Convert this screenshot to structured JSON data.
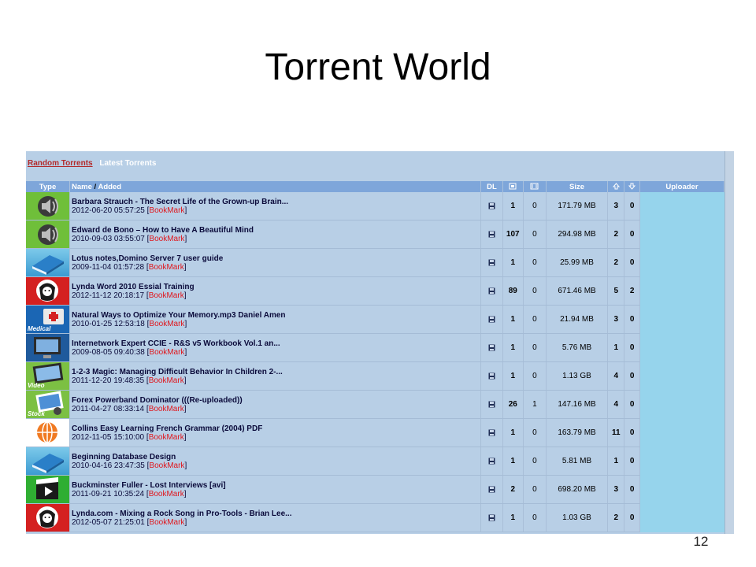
{
  "slide": {
    "title": "Torrent World",
    "page_number": "12"
  },
  "tabs": {
    "random": "Random Torrents",
    "latest": "Latest Torrents"
  },
  "columns": {
    "type": "Type",
    "name": "Name",
    "slash": "/",
    "added": "Added",
    "dl": "DL",
    "size": "Size",
    "uploader": "Uploader"
  },
  "icons": {
    "download": "floppy-disk-icon",
    "seeders_header": "seeders-icon",
    "leechers_header": "leechers-icon",
    "up_header": "arrow-up-icon",
    "down_header": "arrow-down-icon"
  },
  "colors": {
    "header_bg": "#7ea6da",
    "row_bg": "#b8cfe6",
    "bookmark": "#e0151b",
    "uploader_bg": "#96d4ec",
    "random_tab": "#b32a2a"
  },
  "bookmark_label": "BookMark",
  "rows": [
    {
      "thumb": "speaker",
      "thumb_label": "",
      "name": "Barbara Strauch - The Secret Life of the Grown-up Brain...",
      "date": "2012-06-20 05:57:25",
      "seeders": "1",
      "leechers": "0",
      "size": "171.79 MB",
      "up": "3",
      "down": "0"
    },
    {
      "thumb": "speaker",
      "thumb_label": "",
      "name": "Edward de Bono – How to Have A Beautiful Mind",
      "date": "2010-09-03 03:55:07",
      "seeders": "107",
      "leechers": "0",
      "size": "294.98 MB",
      "up": "2",
      "down": "0"
    },
    {
      "thumb": "book",
      "thumb_label": "",
      "name": "Lotus notes,Domino Server 7 user guide",
      "date": "2009-11-04 01:57:28",
      "seeders": "1",
      "leechers": "0",
      "size": "25.99 MB",
      "up": "2",
      "down": "0"
    },
    {
      "thumb": "lynda",
      "thumb_label": "",
      "name": "Lynda Word 2010 Essial Training",
      "date": "2012-11-12 20:18:17",
      "seeders": "89",
      "leechers": "0",
      "size": "671.46 MB",
      "up": "5",
      "down": "2"
    },
    {
      "thumb": "medical",
      "thumb_label": "Medical",
      "name": "Natural Ways to Optimize Your Memory.mp3 Daniel Amen",
      "date": "2010-01-25 12:53:18",
      "seeders": "1",
      "leechers": "0",
      "size": "21.94 MB",
      "up": "3",
      "down": "0"
    },
    {
      "thumb": "network",
      "thumb_label": "",
      "name": "Internetwork Expert CCIE - R&S v5 Workbook Vol.1 an...",
      "date": "2009-08-05 09:40:38",
      "seeders": "1",
      "leechers": "0",
      "size": "5.76 MB",
      "up": "1",
      "down": "0"
    },
    {
      "thumb": "video",
      "thumb_label": "Video",
      "name": "1-2-3 Magic: Managing Difficult Behavior In Children 2-...",
      "date": "2011-12-20 19:48:35",
      "seeders": "1",
      "leechers": "0",
      "size": "1.13 GB",
      "up": "4",
      "down": "0"
    },
    {
      "thumb": "stock",
      "thumb_label": "Stock",
      "name": "Forex Powerband Dominator (((Re-uploaded))",
      "date": "2011-04-27 08:33:14",
      "seeders": "26",
      "leechers": "1",
      "size": "147.16 MB",
      "up": "4",
      "down": "0"
    },
    {
      "thumb": "globe",
      "thumb_label": "",
      "name": "Collins Easy Learning French Grammar (2004) PDF",
      "date": "2012-11-05 15:10:00",
      "seeders": "1",
      "leechers": "0",
      "size": "163.79 MB",
      "up": "11",
      "down": "0"
    },
    {
      "thumb": "book",
      "thumb_label": "",
      "name": "Beginning Database Design",
      "date": "2010-04-16 23:47:35",
      "seeders": "1",
      "leechers": "0",
      "size": "5.81 MB",
      "up": "1",
      "down": "0"
    },
    {
      "thumb": "clap",
      "thumb_label": "",
      "name": "Buckminster Fuller - Lost Interviews [avi]",
      "date": "2011-09-21 10:35:24",
      "seeders": "2",
      "leechers": "0",
      "size": "698.20 MB",
      "up": "3",
      "down": "0"
    },
    {
      "thumb": "lynda",
      "thumb_label": "",
      "name": "Lynda.com - Mixing a Rock Song in Pro-Tools - Brian Lee...",
      "date": "2012-05-07 21:25:01",
      "seeders": "1",
      "leechers": "0",
      "size": "1.03 GB",
      "up": "2",
      "down": "0"
    }
  ]
}
